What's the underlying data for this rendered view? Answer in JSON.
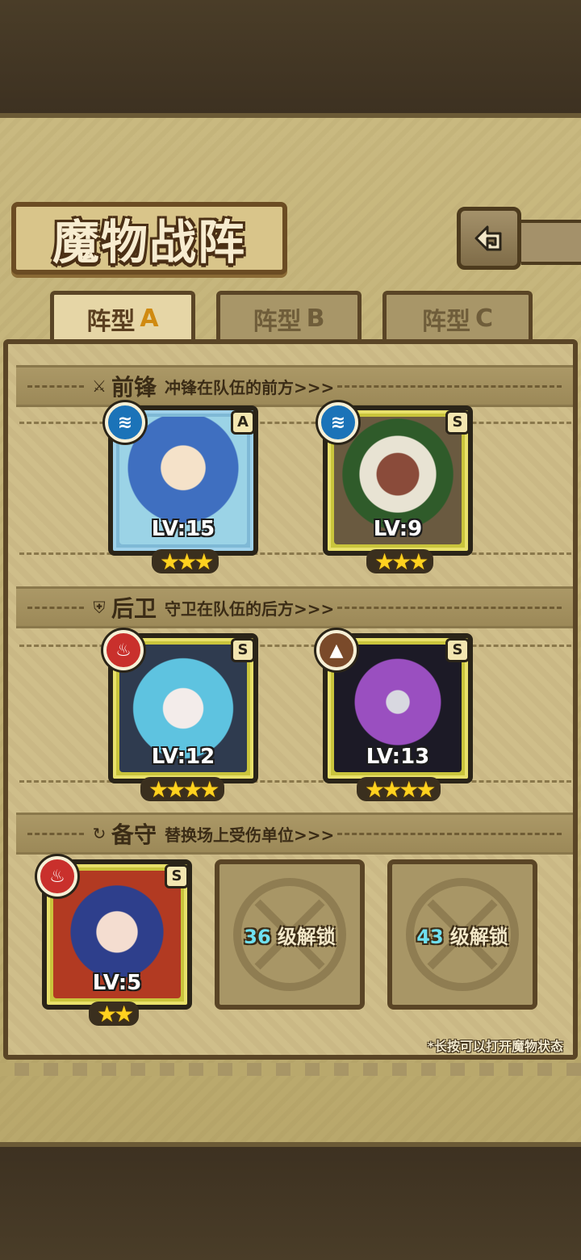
{
  "title": "魔物战阵",
  "tabs": [
    {
      "prefix": "阵型",
      "suffix": "A",
      "active": true
    },
    {
      "prefix": "阵型",
      "suffix": "B",
      "active": false
    },
    {
      "prefix": "阵型",
      "suffix": "C",
      "active": false
    }
  ],
  "sections": {
    "front": {
      "name": "前锋",
      "desc": "冲锋在队伍的前方>>>"
    },
    "back": {
      "name": "后卫",
      "desc": "守卫在队伍的后方>>>"
    },
    "reserve": {
      "name": "备守",
      "desc": "替换场上受伤单位>>>"
    }
  },
  "monsters": [
    {
      "slot": "front-1",
      "rank": "A",
      "element": "water",
      "level": "LV:15",
      "stars": 3
    },
    {
      "slot": "front-2",
      "rank": "S",
      "element": "water",
      "level": "LV:9",
      "stars": 3
    },
    {
      "slot": "back-1",
      "rank": "S",
      "element": "fire",
      "level": "LV:12",
      "stars": 4
    },
    {
      "slot": "back-2",
      "rank": "S",
      "element": "earth",
      "level": "LV:13",
      "stars": 4
    },
    {
      "slot": "reserve-1",
      "rank": "S",
      "element": "fire",
      "level": "LV:5",
      "stars": 2
    }
  ],
  "locked_slots": [
    {
      "level": "36",
      "label": "级解锁"
    },
    {
      "level": "43",
      "label": "级解锁"
    }
  ],
  "hint": "*长按可以打开魔物状态",
  "colors": {
    "water": "#1b73b8",
    "fire": "#c9302c",
    "earth": "#7a4a2a",
    "rank_a": "#7fb9d6",
    "rank_s": "#c9c43c",
    "star": "#ffd21f"
  }
}
